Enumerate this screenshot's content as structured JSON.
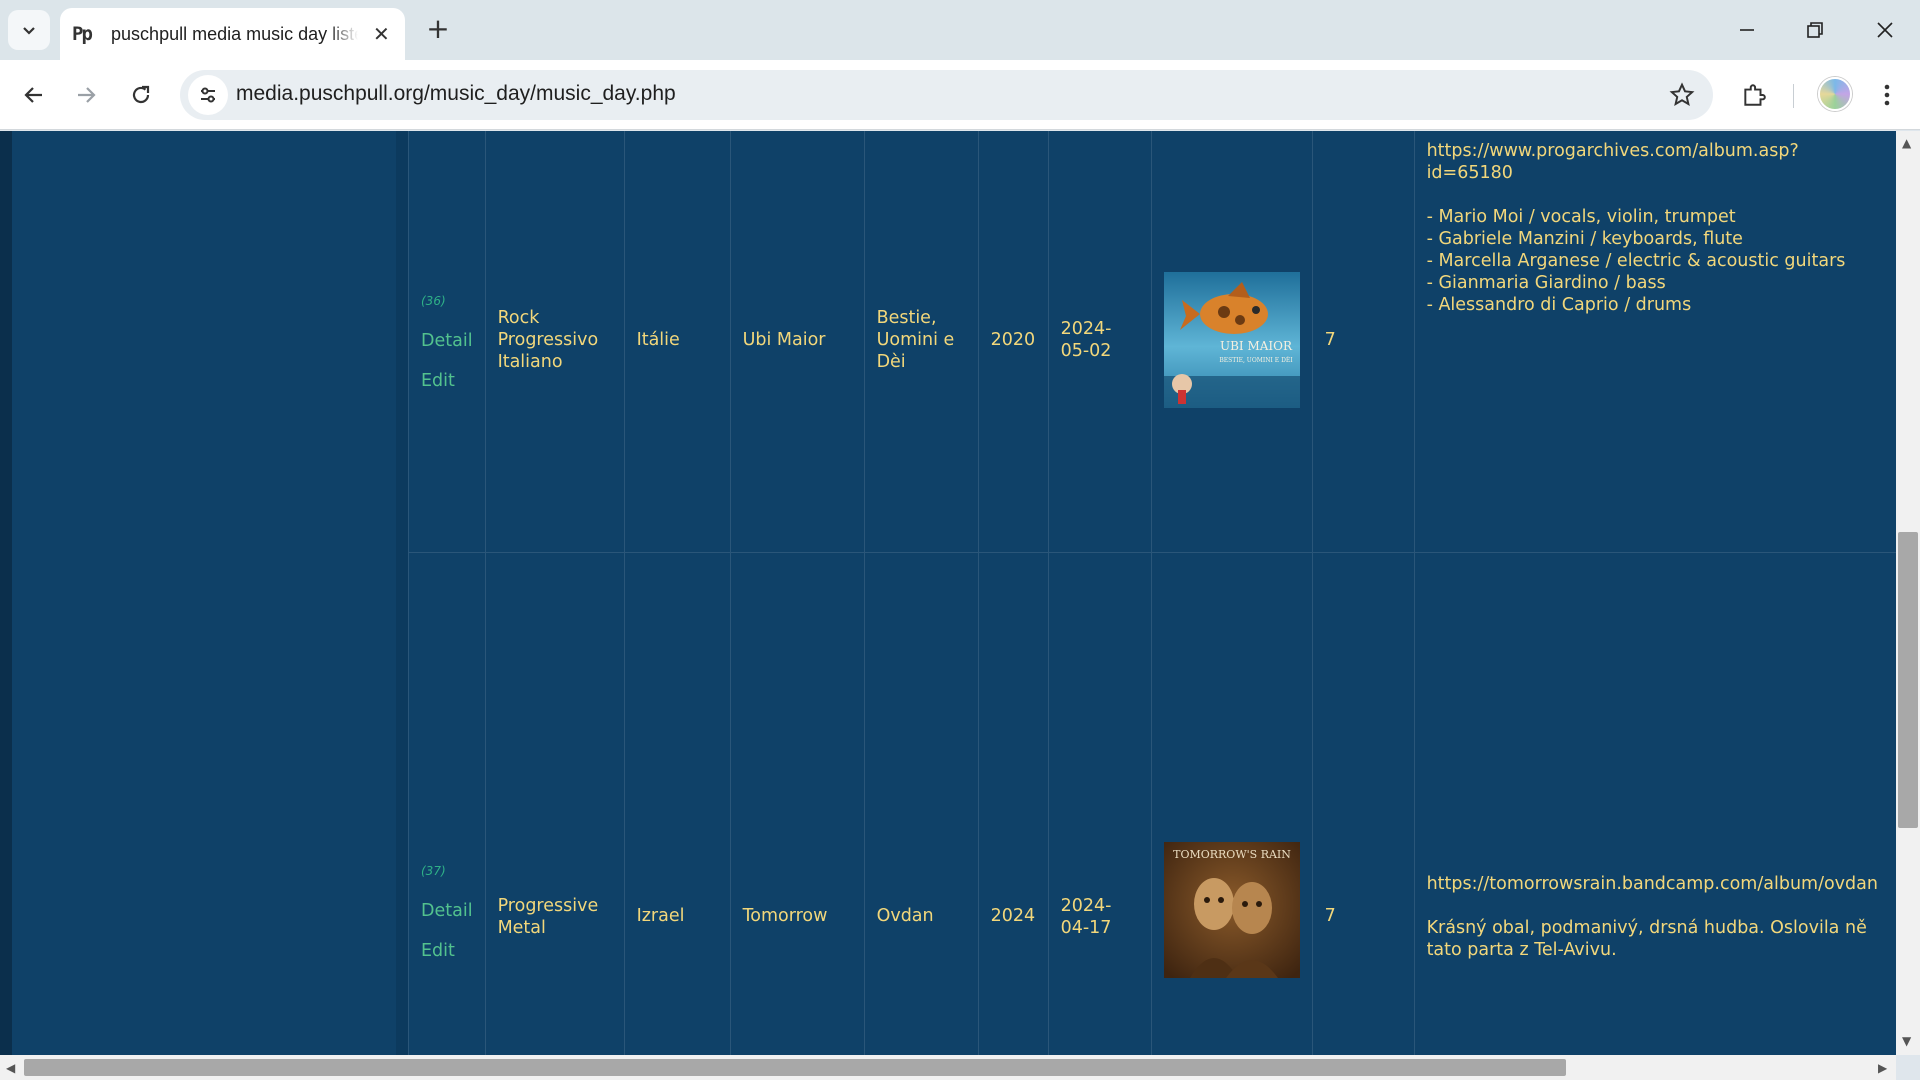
{
  "browser": {
    "tab_title": "puschpull media music day liste",
    "tab_favicon": "Pp",
    "url": "media.puschpull.org/music_day/music_day.php"
  },
  "rows": [
    {
      "num": "(36)",
      "detail": "Detail",
      "edit": "Edit",
      "genre": "Rock Progressivo Italiano",
      "country": "Itálie",
      "artist": "Ubi Maior",
      "album": "Bestie, Uomini e Dèi",
      "year": "2020",
      "date": "2024-05-02",
      "cover_text": "UBI MAIOR",
      "cover_sub": "BESTIE, UOMINI E DÈI",
      "rating": "7",
      "info": [
        "https://www.progarchives.com/album.asp?",
        "id=65180",
        "",
        "- Mario Moi / vocals, violin, trumpet",
        "- Gabriele Manzini / keyboards, flute",
        "- Marcella Arganese / electric & acoustic guitars",
        "- Gianmaria Giardino / bass",
        "- Alessandro di Caprio / drums"
      ]
    },
    {
      "num": "(37)",
      "detail": "Detail",
      "edit": "Edit",
      "genre": "Progressive Metal",
      "country": "Izrael",
      "artist": "Tomorrow",
      "album": "Ovdan",
      "year": "2024",
      "date": "2024-04-17",
      "cover_text": "TOMORROW'S RAIN",
      "rating": "7",
      "info": [
        "https://tomorrowsrain.bandcamp.com/album/ovdan",
        "",
        "Krásný obal, podmanivý, drsná hudba. Oslovila ně",
        "tato parta z Tel-Avivu."
      ]
    }
  ]
}
